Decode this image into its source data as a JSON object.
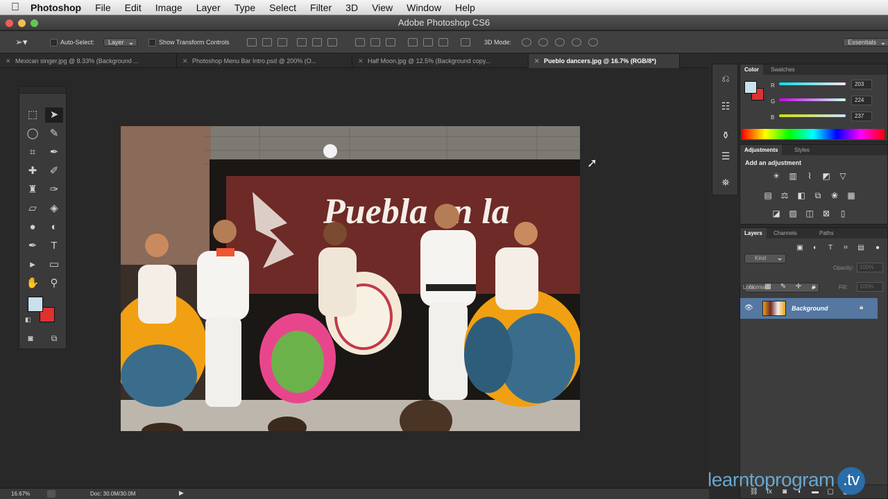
{
  "menubar": {
    "app_name": "Photoshop",
    "items": [
      "File",
      "Edit",
      "Image",
      "Layer",
      "Type",
      "Select",
      "Filter",
      "3D",
      "View",
      "Window",
      "Help"
    ]
  },
  "window": {
    "title": "Adobe Photoshop CS6"
  },
  "options_bar": {
    "auto_select_label": "Auto-Select:",
    "auto_select_value": "Layer",
    "show_transform_label": "Show Transform Controls",
    "mode_3d_label": "3D Mode:",
    "workspace_value": "Essentials"
  },
  "tabs": [
    {
      "label": "Mexican singer.jpg @ 8.33% (Background ..."
    },
    {
      "label": "Photoshop Menu Bar Intro.psd @ 200% (O..."
    },
    {
      "label": "Half Moon.jpg @ 12.5% (Background copy..."
    },
    {
      "label": "Pueblo dancers.jpg @ 16.7% (RGB/8*)"
    }
  ],
  "photo": {
    "banner_text": "Puebla en la"
  },
  "status": {
    "zoom": "16.67%",
    "doc": "Doc: 30.0M/30.0M"
  },
  "color_panel": {
    "tabs": [
      "Color",
      "Swatches"
    ],
    "r_label": "R",
    "g_label": "G",
    "b_label": "B",
    "r": "203",
    "g": "224",
    "b": "237",
    "foreground": "#cbe0ed",
    "background": "#e03030"
  },
  "adjustments_panel": {
    "tabs": [
      "Adjustments",
      "Styles"
    ],
    "heading": "Add an adjustment"
  },
  "layers_panel": {
    "tabs": [
      "Layers",
      "Channels",
      "Paths"
    ],
    "kind_label": "Kind",
    "blend_mode": "Normal",
    "opacity_label": "Opacity:",
    "opacity_value": "100%",
    "lock_label": "Lock:",
    "fill_label": "Fill:",
    "fill_value": "100%",
    "layers": [
      {
        "name": "Background"
      }
    ]
  },
  "watermark": {
    "text": "learntoprogram",
    "suffix": ".tv"
  }
}
